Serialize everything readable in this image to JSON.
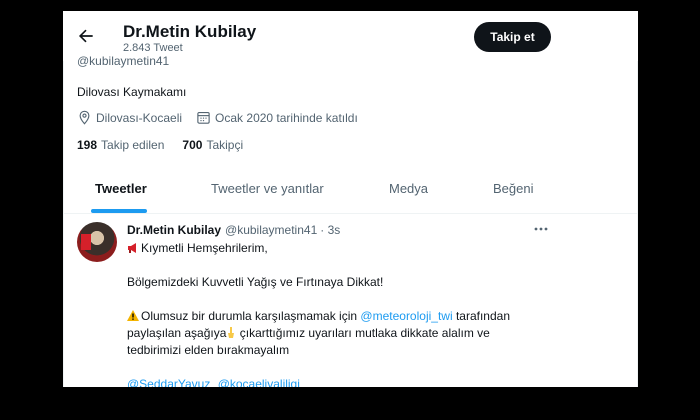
{
  "header": {
    "name": "Dr.Metin Kubilay",
    "tweet_count": "2.843 Tweet",
    "follow_label": "Takip et"
  },
  "profile": {
    "handle": "@kubilaymetin41",
    "bio": "Dilovası Kaymakamı",
    "location": "Dilovası-Kocaeli",
    "joined": "Ocak 2020 tarihinde katıldı",
    "following_count": "198",
    "following_label": "Takip edilen",
    "followers_count": "700",
    "followers_label": "Takipçi"
  },
  "tabs": [
    {
      "label": "Tweetler"
    },
    {
      "label": "Tweetler ve yanıtlar"
    },
    {
      "label": "Medya"
    },
    {
      "label": "Beğeni"
    }
  ],
  "tweet": {
    "name": "Dr.Metin Kubilay",
    "handle": "@kubilaymetin41",
    "time": "· 3s",
    "line1": "Kıymetli Hemşehrilerim,",
    "line2": "Bölgemizdeki Kuvvetli Yağış ve Fırtınaya Dikkat!",
    "line3a": "Olumsuz bir durumla karşılaşmamak için ",
    "line3_link": "@meteoroloji_twi",
    "line3b": " tarafından",
    "line4a": "paylaşılan aşağıya",
    "line4b": " çıkarttığımız uyarıları mutlaka dikkate alalım ve",
    "line5": "tedbirimizi elden bırakmayalım",
    "mention1": "@SeddarYavuz",
    "mention2": "@kocaelivaliligi"
  },
  "colors": {
    "accent": "#1d9bf0",
    "text": "#0f1419",
    "muted": "#536471"
  },
  "icons": {
    "back": "arrow-left-icon",
    "location": "location-pin-icon",
    "calendar": "calendar-icon",
    "more": "more-icon"
  }
}
